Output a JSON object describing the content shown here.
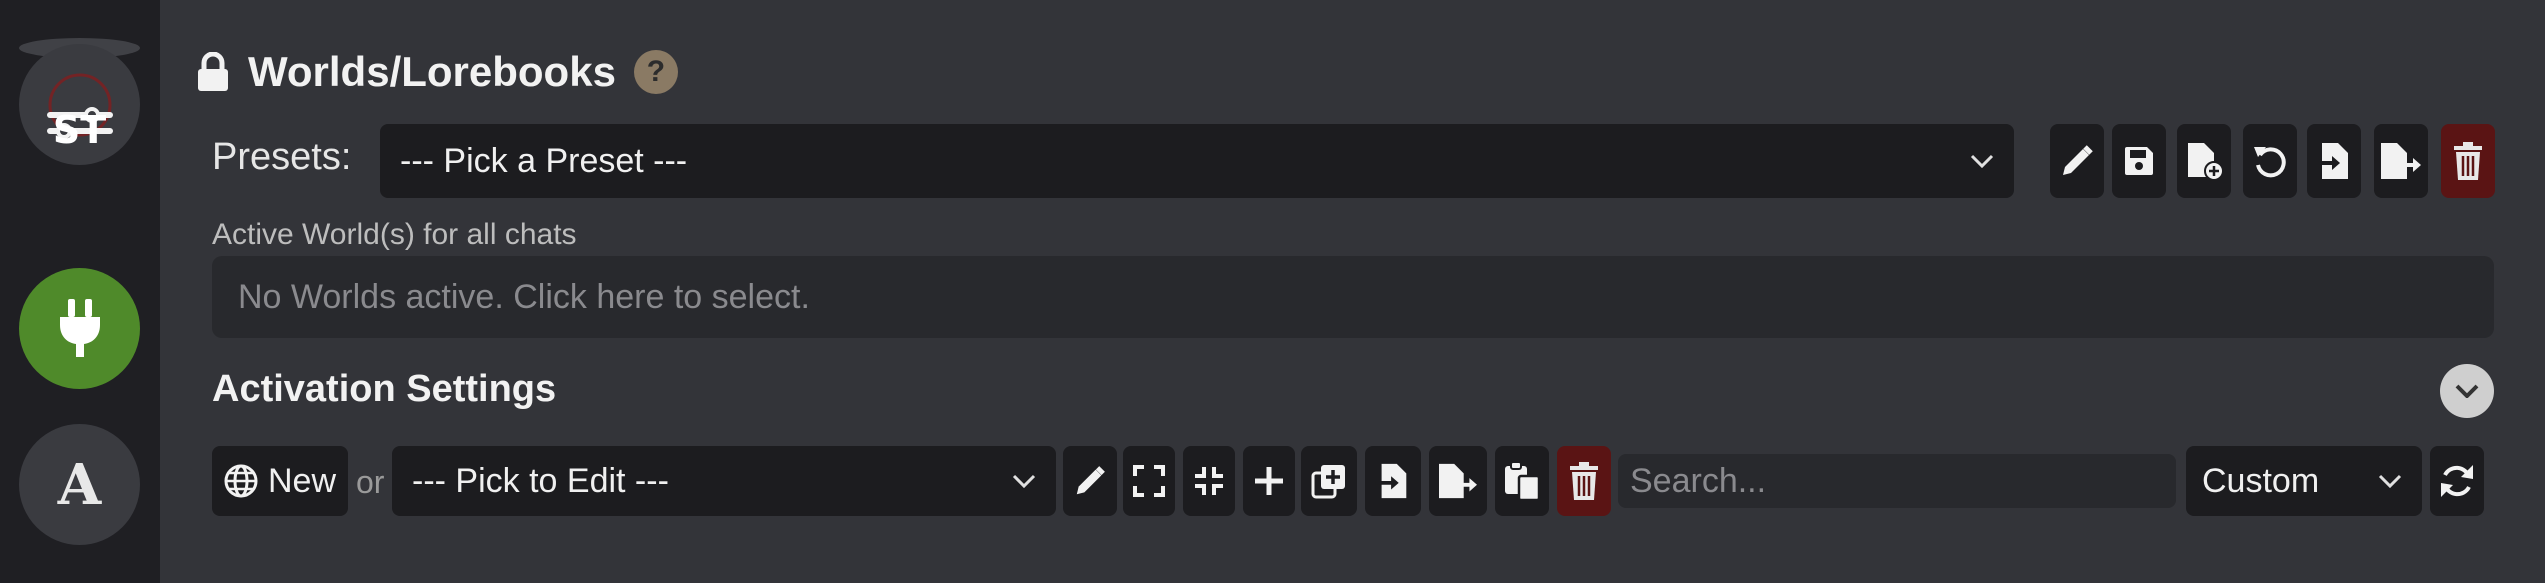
{
  "sidebar": {
    "logo_text": "ST",
    "letter_button": "A"
  },
  "header": {
    "title": "Worlds/Lorebooks",
    "help": "?"
  },
  "presets": {
    "label": "Presets:",
    "selected": "--- Pick a Preset ---",
    "actions": [
      "edit-icon",
      "save-icon",
      "new-file-icon",
      "undo-icon",
      "import-icon",
      "export-icon",
      "delete-icon"
    ]
  },
  "active_worlds": {
    "label": "Active World(s) for all chats",
    "placeholder": "No Worlds active. Click here to select."
  },
  "activation": {
    "title": "Activation Settings"
  },
  "editor": {
    "new_label": "New",
    "or_label": "or",
    "pick_selected": "--- Pick to Edit ---",
    "search_placeholder": "Search...",
    "sort_selected": "Custom"
  },
  "colors": {
    "accent_green": "#4f8a2a",
    "danger": "#5a1414"
  }
}
